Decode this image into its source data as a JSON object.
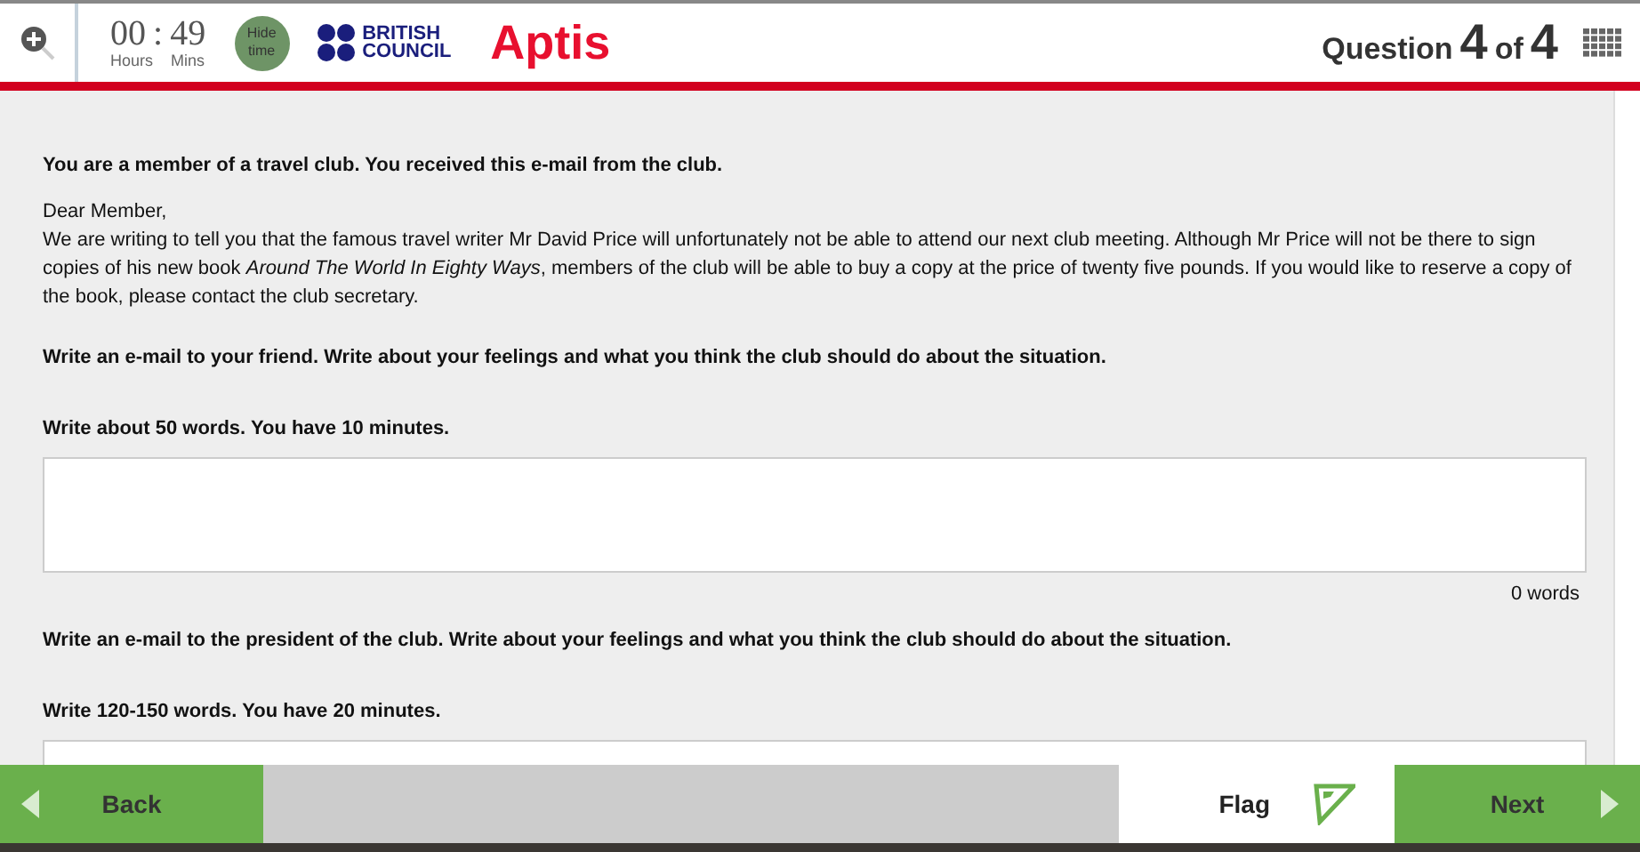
{
  "header": {
    "timer": {
      "hours": "00",
      "separator": ":",
      "minutes": "49",
      "hours_label": "Hours",
      "minutes_label": "Mins"
    },
    "hide_time_button": "Hide time",
    "brand": [
      "BRITISH",
      "COUNCIL"
    ],
    "product": "Aptis",
    "question": {
      "label": "Question",
      "current": "4",
      "of": "of",
      "total": "4"
    }
  },
  "content": {
    "intro": "You are a member of a travel club. You received this e-mail from the club.",
    "greeting": "Dear Member,",
    "email": "We are writing to tell you that the famous travel writer Mr David Price will unfortunately not be able to attend our next club meeting. Although Mr Price will not be there to sign copies of his new book *Around The World In Eighty Ways*, members of the club will be able to buy a copy at the price of twenty five pounds. If you would like to reserve a copy of the book, please contact the club secretary.",
    "tasks": [
      {
        "instruction": "Write an e-mail to your friend. Write about your feelings and what you think the club should do about the situation.",
        "limit": "Write about 50 words. You have 10 minutes.",
        "word_count": "0 words"
      },
      {
        "instruction": "Write an e-mail to the president of the club. Write about your feelings and what you think the club should do about the situation.",
        "limit": "Write 120-150 words. You have 20 minutes."
      }
    ]
  },
  "footer": {
    "back": "Back",
    "flag": "Flag",
    "next": "Next"
  }
}
